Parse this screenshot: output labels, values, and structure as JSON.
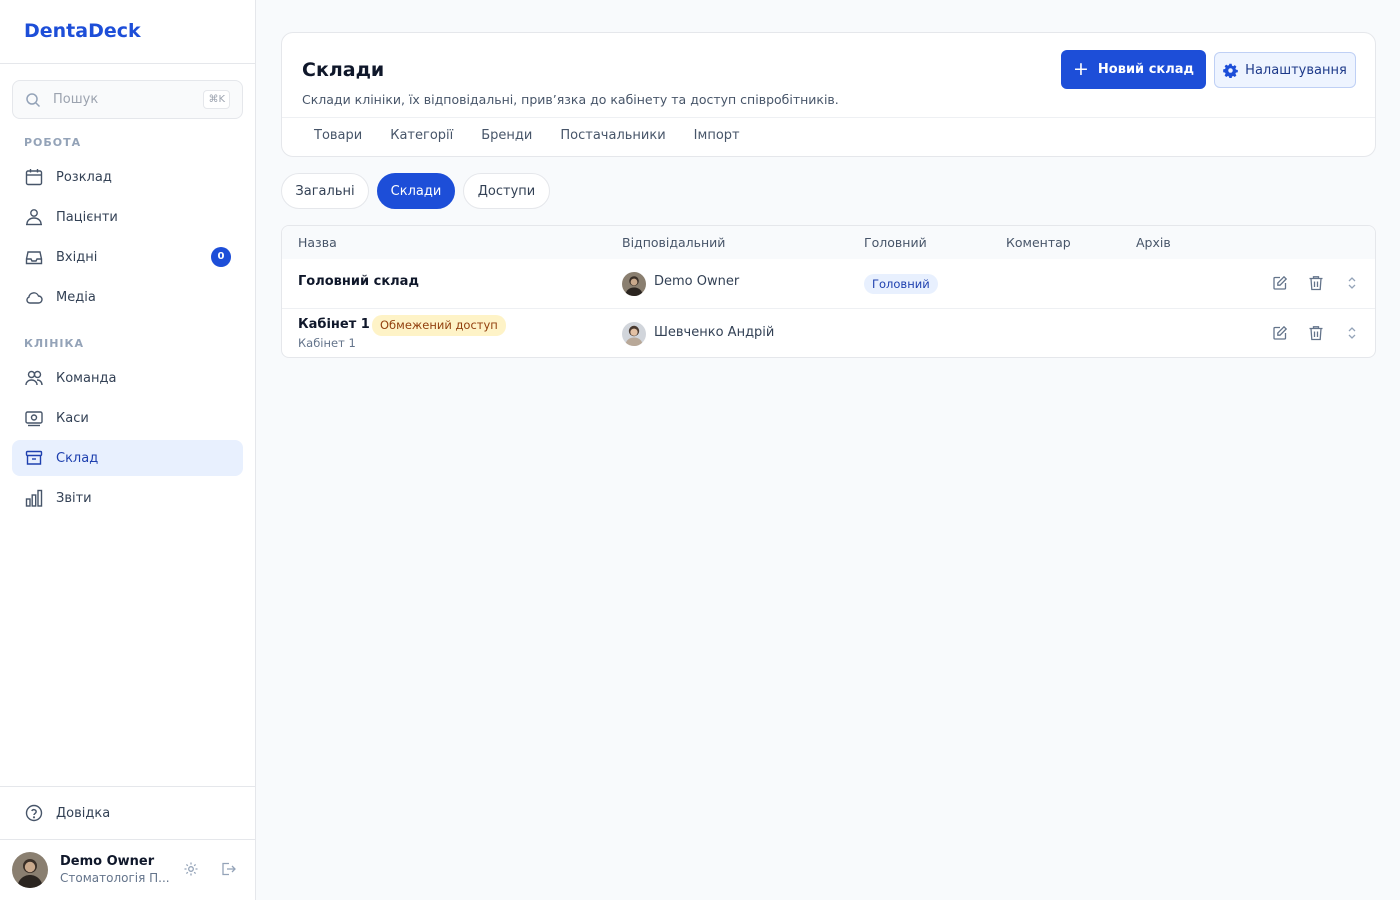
{
  "app": {
    "brand": "DentaDeck"
  },
  "search": {
    "placeholder": "Пошук",
    "shortcut": "⌘K"
  },
  "sidebar": {
    "sections": [
      {
        "label": "РОБОТА"
      },
      {
        "label": "КЛІНІКА"
      }
    ],
    "items": [
      {
        "label": "Розклад",
        "icon": "calendar-icon"
      },
      {
        "label": "Пацієнти",
        "icon": "patients-icon"
      },
      {
        "label": "Вхідні",
        "icon": "inbox-icon",
        "badge": "0"
      },
      {
        "label": "Медіа",
        "icon": "cloud-icon"
      },
      {
        "label": "Команда",
        "icon": "team-icon"
      },
      {
        "label": "Каси",
        "icon": "cash-register-icon"
      },
      {
        "label": "Склад",
        "icon": "archive-box-icon",
        "active": true
      },
      {
        "label": "Звіти",
        "icon": "bar-chart-icon"
      }
    ],
    "help": {
      "label": "Довідка",
      "icon": "help-circle-icon"
    },
    "user": {
      "name": "Demo Owner",
      "org": "Стоматологія П..."
    }
  },
  "header": {
    "title": "Склади",
    "subtitle": "Склади клініки, їх відповідальні, прив’язка до кабінету та доступ співробітників.",
    "primary_button": "Новий склад",
    "settings_button": "Налаштування",
    "subnav": [
      "Товари",
      "Категорії",
      "Бренди",
      "Постачальники",
      "Імпорт"
    ]
  },
  "tabs": [
    {
      "label": "Загальні",
      "active": false
    },
    {
      "label": "Склади",
      "active": true
    },
    {
      "label": "Доступи",
      "active": false
    }
  ],
  "table": {
    "columns": [
      "Назва",
      "Відповідальний",
      "Головний",
      "Коментар",
      "Архів"
    ],
    "rows": [
      {
        "name": "Головний склад",
        "responsible": "Demo Owner",
        "main_tag": "Головний"
      },
      {
        "name": "Кабінет 1",
        "tag": "Обмежений доступ",
        "sub": "Кабінет 1",
        "responsible": "Шевченко Андрій"
      }
    ]
  },
  "colors": {
    "accent": "#1d4ed8",
    "warn_bg": "#fef3c7",
    "active_nav_bg": "#e8f0fe"
  }
}
